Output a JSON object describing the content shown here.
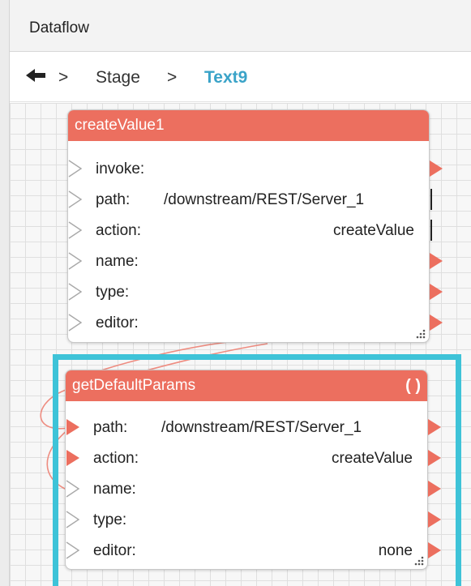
{
  "header": {
    "title": "Dataflow"
  },
  "breadcrumb": {
    "separator": ">",
    "items": [
      "Stage",
      "Text9"
    ]
  },
  "colors": {
    "node_header": "#ec6f5f",
    "selection": "#3ec3d8",
    "link": "#3aa3c8"
  },
  "nodes": [
    {
      "title": "createValue1",
      "rows": [
        {
          "label": "invoke:",
          "value": ""
        },
        {
          "label": "path:",
          "value": "/downstream/REST/Server_1"
        },
        {
          "label": "action:",
          "value": "createValue"
        },
        {
          "label": "name:",
          "value": ""
        },
        {
          "label": "type:",
          "value": ""
        },
        {
          "label": "editor:",
          "value": ""
        }
      ]
    },
    {
      "title": "getDefaultParams",
      "toggle": "( )",
      "rows": [
        {
          "label": "path:",
          "value": "/downstream/REST/Server_1"
        },
        {
          "label": "action:",
          "value": "createValue"
        },
        {
          "label": "name:",
          "value": ""
        },
        {
          "label": "type:",
          "value": ""
        },
        {
          "label": "editor:",
          "value": "none"
        }
      ]
    }
  ]
}
